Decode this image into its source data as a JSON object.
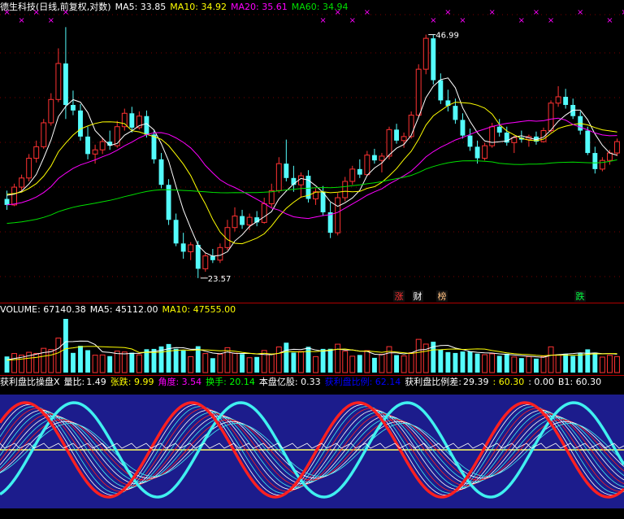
{
  "price_panel": {
    "title": "德生科技(日线,前复权,对数)",
    "ma5_label": "MA5: 33.85",
    "ma10_label": "MA10: 34.92",
    "ma20_label": "MA20: 35.61",
    "ma60_label": "MA60: 34.94",
    "high_label": "46.99",
    "low_label": "23.57",
    "markers": [
      "涨",
      "财",
      "榜",
      "跌"
    ],
    "colors": {
      "up": "#ff3232",
      "down": "#54fcfc",
      "ma5": "#ffffff",
      "ma10": "#ffff00",
      "ma20": "#ff00ff",
      "ma60": "#00e000",
      "signal": "#ff00ff"
    }
  },
  "volume_panel": {
    "volume_label": "VOLUME: 67140.38",
    "ma5_label": "MA5: 45112.00",
    "ma10_label": "MA10: 47555.00"
  },
  "indicator_panel": {
    "name": "获利盘比操盘X",
    "liangbi_label": "量比:",
    "liangbi_value": "1.49",
    "zhangdie": "张跌: 9.99",
    "jiaodu": "角度: 3.54",
    "huanshou": "换手: 20.14",
    "benpan": "本盘亿股: 0.33",
    "huolipan": "获利盘比例: 62.14",
    "huolipan_cha_label": "获利盘比例差:",
    "huolipan_cha_value": "29.39",
    "val1": ": 60.30",
    "val2": ": 0.00",
    "b1": "B1: 60.30",
    "colors": {
      "bg": "#1c1c8c",
      "red": "#ff2020",
      "cyan": "#40f0f0",
      "white": "#ffffff",
      "yellow": "#ffff60"
    }
  },
  "chart_data": {
    "type": "candlestick",
    "title": "德生科技(日线,前复权,对数)",
    "log_scale": true,
    "annotations": {
      "max": 46.99,
      "min": 23.57
    },
    "ma_current": {
      "MA5": 33.85,
      "MA10": 34.92,
      "MA20": 35.61,
      "MA60": 34.94
    },
    "ohlc": [
      [
        29.5,
        30.2,
        28.6,
        29.0
      ],
      [
        29.0,
        30.8,
        28.9,
        30.5
      ],
      [
        30.5,
        31.6,
        30.2,
        31.3
      ],
      [
        31.3,
        33.5,
        31.0,
        33.1
      ],
      [
        33.1,
        34.8,
        32.7,
        34.2
      ],
      [
        34.2,
        37.0,
        34.0,
        36.6
      ],
      [
        36.6,
        39.8,
        36.3,
        39.1
      ],
      [
        39.1,
        45.2,
        38.8,
        43.3
      ],
      [
        43.3,
        48.0,
        37.0,
        38.5
      ],
      [
        38.5,
        40.1,
        37.4,
        37.9
      ],
      [
        37.9,
        38.6,
        34.8,
        35.2
      ],
      [
        35.2,
        36.2,
        33.0,
        33.5
      ],
      [
        33.5,
        34.4,
        32.6,
        33.9
      ],
      [
        33.9,
        35.1,
        33.5,
        34.7
      ],
      [
        34.7,
        35.8,
        33.9,
        34.3
      ],
      [
        34.3,
        36.8,
        34.1,
        36.2
      ],
      [
        36.2,
        38.1,
        35.8,
        37.6
      ],
      [
        37.6,
        38.3,
        35.6,
        36.1
      ],
      [
        36.1,
        37.8,
        35.9,
        37.3
      ],
      [
        37.3,
        37.9,
        35.1,
        35.4
      ],
      [
        35.4,
        35.8,
        32.6,
        33.0
      ],
      [
        33.0,
        33.6,
        30.4,
        30.7
      ],
      [
        30.7,
        31.2,
        27.4,
        27.8
      ],
      [
        27.8,
        28.3,
        25.8,
        26.0
      ],
      [
        26.0,
        26.8,
        24.9,
        25.4
      ],
      [
        25.4,
        26.1,
        24.8,
        25.9
      ],
      [
        25.9,
        26.2,
        23.57,
        24.2
      ],
      [
        24.2,
        25.3,
        24.0,
        25.1
      ],
      [
        25.1,
        25.6,
        24.6,
        24.8
      ],
      [
        24.8,
        26.0,
        24.6,
        25.7
      ],
      [
        25.7,
        27.8,
        25.5,
        27.2
      ],
      [
        27.2,
        28.8,
        26.9,
        28.1
      ],
      [
        28.1,
        28.6,
        27.1,
        27.4
      ],
      [
        27.4,
        28.3,
        27.0,
        28.0
      ],
      [
        28.0,
        28.5,
        27.3,
        27.6
      ],
      [
        27.6,
        29.6,
        27.5,
        29.1
      ],
      [
        29.1,
        30.8,
        28.8,
        30.2
      ],
      [
        30.2,
        33.2,
        30.0,
        32.6
      ],
      [
        32.6,
        34.9,
        31.0,
        31.3
      ],
      [
        31.3,
        32.4,
        30.1,
        30.7
      ],
      [
        30.7,
        31.8,
        29.6,
        31.5
      ],
      [
        31.5,
        32.0,
        29.2,
        29.5
      ],
      [
        29.5,
        30.4,
        29.0,
        30.1
      ],
      [
        30.1,
        30.6,
        28.1,
        28.4
      ],
      [
        28.4,
        29.2,
        26.4,
        26.8
      ],
      [
        26.8,
        30.0,
        26.6,
        29.6
      ],
      [
        29.6,
        31.4,
        29.3,
        31.0
      ],
      [
        31.0,
        32.4,
        30.7,
        32.1
      ],
      [
        32.1,
        33.0,
        31.3,
        31.6
      ],
      [
        31.6,
        33.8,
        31.5,
        33.4
      ],
      [
        33.4,
        34.0,
        32.6,
        32.9
      ],
      [
        32.9,
        33.6,
        31.8,
        33.3
      ],
      [
        33.3,
        36.2,
        33.0,
        35.9
      ],
      [
        35.9,
        36.5,
        34.5,
        34.8
      ],
      [
        34.8,
        35.6,
        34.1,
        35.2
      ],
      [
        35.2,
        37.8,
        35.0,
        37.4
      ],
      [
        37.4,
        43.2,
        37.2,
        42.6
      ],
      [
        42.6,
        46.99,
        42.0,
        46.5
      ],
      [
        46.5,
        47.0,
        40.8,
        41.3
      ],
      [
        41.3,
        42.1,
        38.6,
        39.0
      ],
      [
        39.0,
        40.2,
        37.8,
        38.4
      ],
      [
        38.4,
        39.2,
        36.5,
        36.9
      ],
      [
        36.9,
        37.6,
        35.0,
        35.3
      ],
      [
        35.3,
        36.0,
        33.8,
        34.2
      ],
      [
        34.2,
        34.8,
        32.6,
        33.1
      ],
      [
        33.1,
        34.6,
        32.9,
        34.3
      ],
      [
        34.3,
        36.6,
        34.1,
        36.2
      ],
      [
        36.2,
        37.0,
        35.2,
        35.6
      ],
      [
        35.6,
        36.2,
        34.3,
        34.6
      ],
      [
        34.6,
        35.3,
        33.6,
        35.1
      ],
      [
        35.1,
        35.8,
        34.6,
        34.9
      ],
      [
        34.9,
        35.4,
        34.2,
        35.2
      ],
      [
        35.2,
        35.7,
        34.4,
        34.7
      ],
      [
        34.7,
        36.1,
        34.6,
        35.8
      ],
      [
        35.8,
        39.0,
        35.6,
        38.7
      ],
      [
        38.7,
        40.6,
        38.3,
        39.4
      ],
      [
        39.4,
        40.3,
        38.1,
        38.5
      ],
      [
        38.5,
        39.2,
        37.0,
        37.3
      ],
      [
        37.3,
        37.8,
        35.4,
        35.8
      ],
      [
        35.8,
        36.2,
        33.4,
        33.6
      ],
      [
        33.6,
        34.2,
        31.7,
        32.1
      ],
      [
        32.1,
        33.2,
        31.9,
        32.9
      ],
      [
        32.9,
        33.9,
        32.5,
        33.6
      ],
      [
        33.6,
        35.0,
        33.3,
        34.7
      ]
    ]
  }
}
